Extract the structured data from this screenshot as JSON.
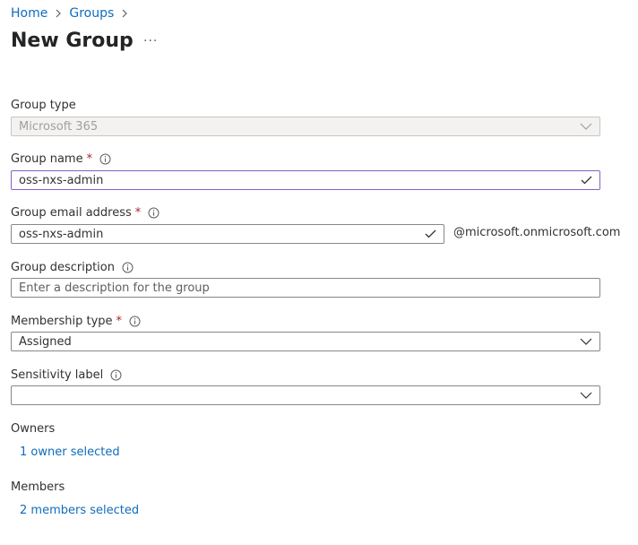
{
  "breadcrumb": {
    "home": "Home",
    "groups": "Groups"
  },
  "page": {
    "title": "New Group",
    "more": "···"
  },
  "group_type": {
    "label": "Group type",
    "value": "Microsoft 365"
  },
  "group_name": {
    "label": "Group name",
    "required": "*",
    "value": "oss-nxs-admin"
  },
  "group_email": {
    "label": "Group email address",
    "required": "*",
    "value": "oss-nxs-admin",
    "suffix": "@microsoft.onmicrosoft.com"
  },
  "group_description": {
    "label": "Group description",
    "placeholder": "Enter a description for the group"
  },
  "membership_type": {
    "label": "Membership type",
    "required": "*",
    "value": "Assigned"
  },
  "sensitivity_label": {
    "label": "Sensitivity label",
    "value": ""
  },
  "owners": {
    "label": "Owners",
    "link": "1 owner selected"
  },
  "members": {
    "label": "Members",
    "link": "2 members selected"
  },
  "colors": {
    "link": "#0f6cbd",
    "required": "#a4262c",
    "focus_border": "#8661c5"
  }
}
